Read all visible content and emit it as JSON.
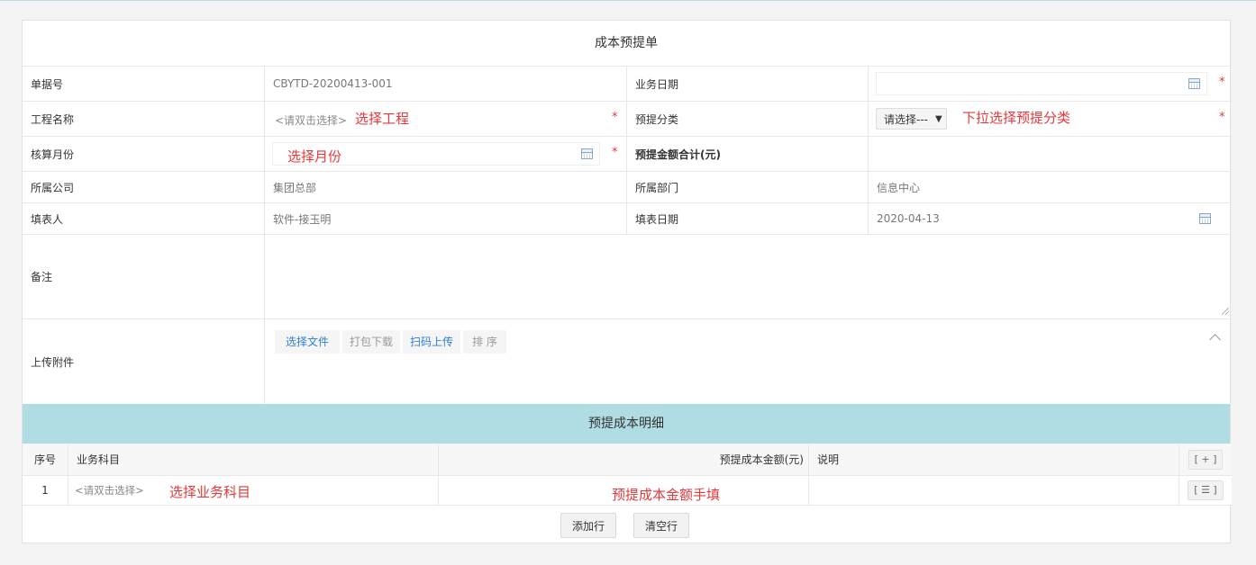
{
  "form": {
    "title": "成本预提单",
    "fields": {
      "doc_no_label": "单据号",
      "doc_no_value": "CBYTD-20200413-001",
      "biz_date_label": "业务日期",
      "project_label": "工程名称",
      "project_placeholder": "<请双击选择>",
      "accrual_type_label": "预提分类",
      "accrual_type_value": "请选择---",
      "month_label": "核算月份",
      "total_label": "预提金额合计(元)",
      "company_label": "所属公司",
      "company_value": "集团总部",
      "dept_label": "所属部门",
      "dept_value": "信息中心",
      "filler_label": "填表人",
      "filler_value": "软件-接玉明",
      "fill_date_label": "填表日期",
      "fill_date_value": "2020-04-13",
      "remark_label": "备注",
      "attach_label": "上传附件"
    },
    "required_mark": "*",
    "attach_buttons": {
      "choose": "选择文件",
      "pack": "打包下载",
      "scan": "扫码上传",
      "sort": "排 序"
    },
    "annotations": {
      "project": "选择工程",
      "accrual_type": "下拉选择预提分类",
      "month": "选择月份",
      "subject": "选择业务科目",
      "amount": "预提成本金额手填"
    }
  },
  "detail": {
    "title": "预提成本明细",
    "columns": {
      "seq": "序号",
      "subject": "业务科目",
      "amount": "预提成本金额(元)",
      "desc": "说明",
      "add": "[ + ]"
    },
    "rows": [
      {
        "seq": "1",
        "subject": "<请双击选择>",
        "del": "[ ☰ ]"
      }
    ],
    "add_row": "添加行",
    "clear_rows": "清空行"
  },
  "colors": {
    "accent_required": "#e4393c",
    "section_header": "#b0dde4",
    "link_blue": "#2f7fcf"
  }
}
